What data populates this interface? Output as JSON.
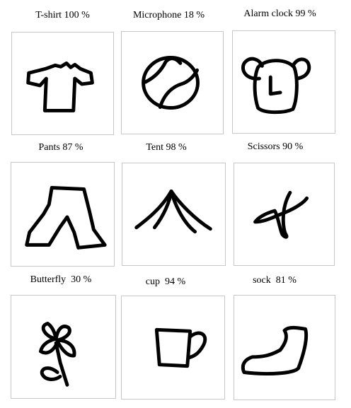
{
  "items": [
    {
      "label": "T-shirt 100 %",
      "icon": "t-shirt-doodle"
    },
    {
      "label": "Microphone 18 %",
      "icon": "microphone-doodle"
    },
    {
      "label": "Alarm clock 99 %",
      "icon": "alarm-clock-doodle"
    },
    {
      "label": "Pants 87 %",
      "icon": "pants-doodle"
    },
    {
      "label": "Tent 98 %",
      "icon": "tent-doodle"
    },
    {
      "label": "Scissors 90 %",
      "icon": "scissors-doodle"
    },
    {
      "label": "Butterfly  30 %",
      "icon": "butterfly-doodle"
    },
    {
      "label": "cup  94 %",
      "icon": "cup-doodle"
    },
    {
      "label": "sock  81 %",
      "icon": "sock-doodle"
    }
  ]
}
